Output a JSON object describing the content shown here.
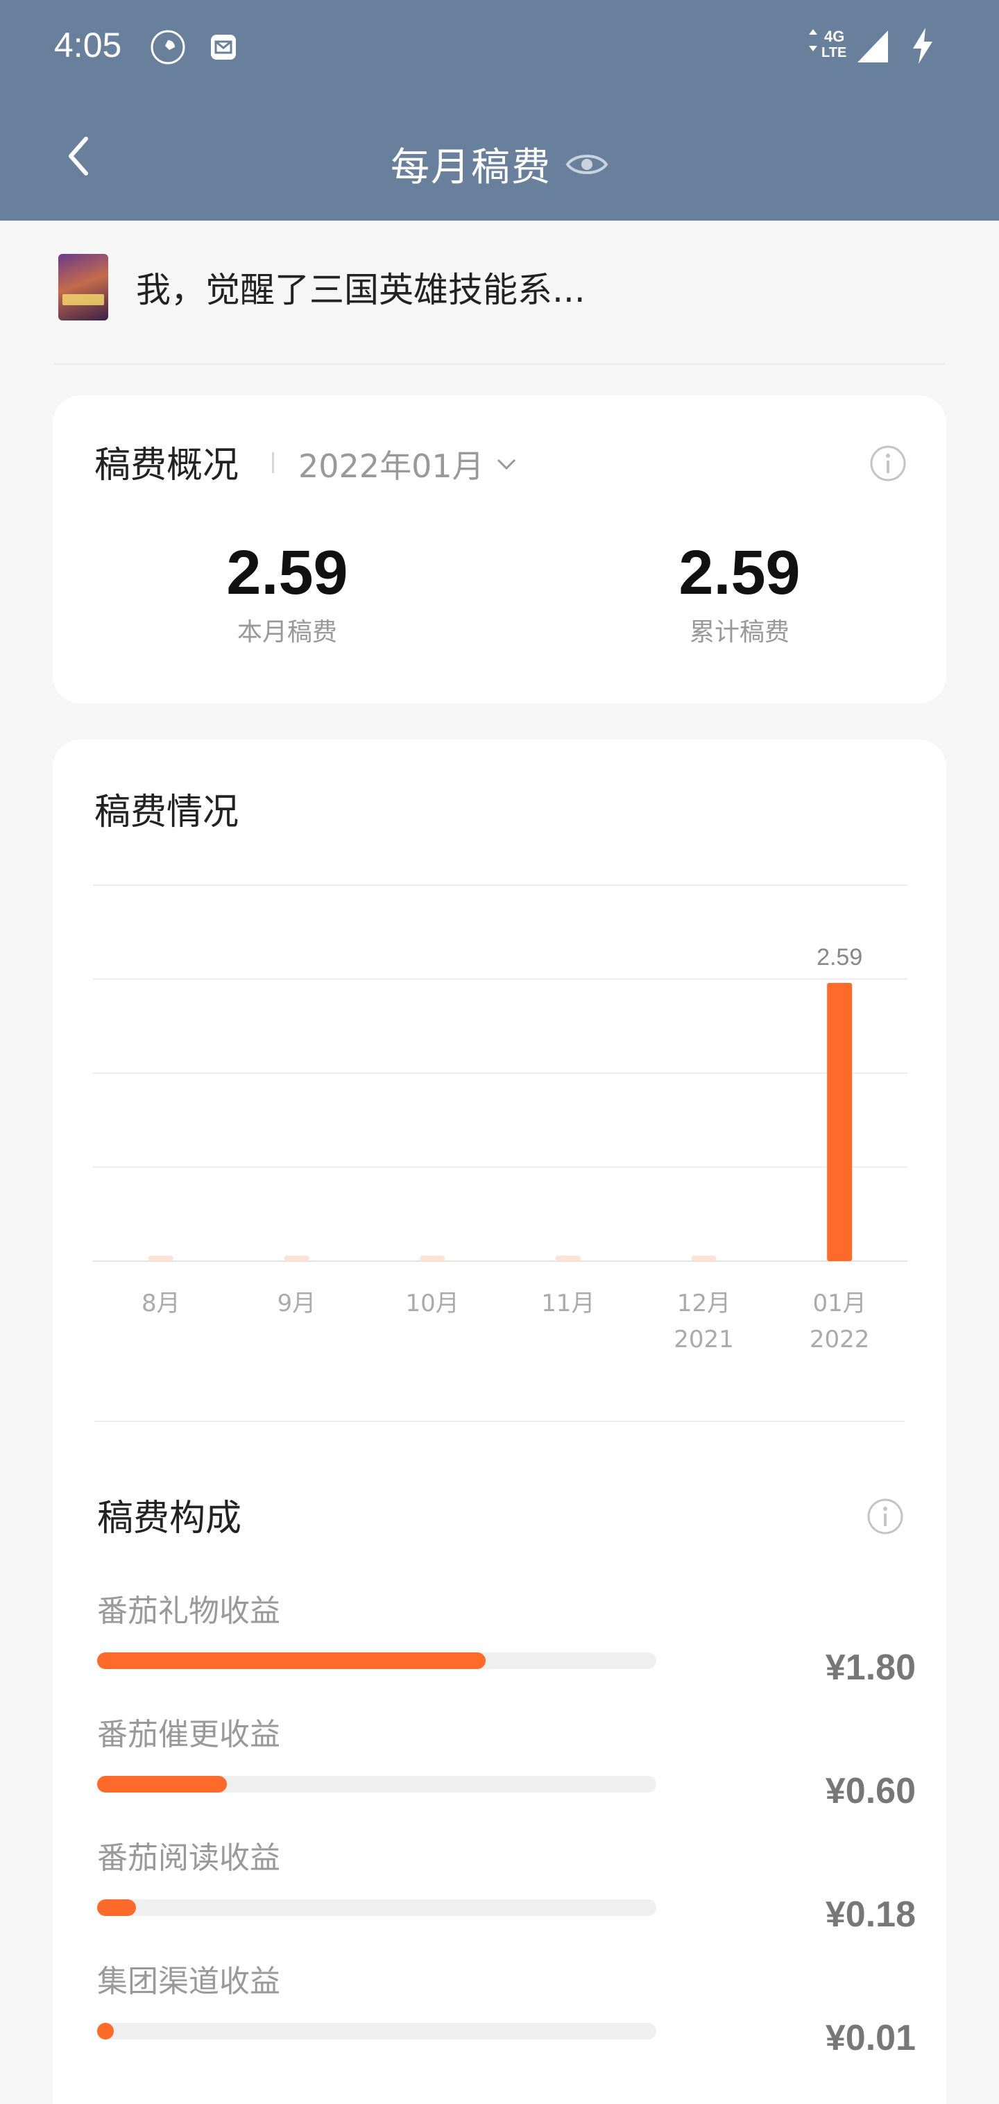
{
  "status_bar": {
    "time": "4:05",
    "left_icons": [
      "rocket-icon",
      "mail-icon"
    ],
    "network": "4G LTE",
    "right_icons": [
      "signal-icon",
      "charging-icon"
    ]
  },
  "nav": {
    "back_icon": "chevron-left-icon",
    "title": "每月稿费",
    "title_icon": "eye-icon"
  },
  "book": {
    "title": "我，觉醒了三国英雄技能系..."
  },
  "overview": {
    "heading": "稿费概况",
    "month": "2022年01月",
    "stats": [
      {
        "value": "2.59",
        "label": "本月稿费"
      },
      {
        "value": "2.59",
        "label": "累计稿费"
      }
    ]
  },
  "chart_section": {
    "heading": "稿费情况"
  },
  "chart_data": {
    "type": "bar",
    "categories": [
      "8月",
      "9月",
      "10月",
      "11月",
      "12月\n2021",
      "01月\n2022"
    ],
    "category_lines": [
      [
        "8月"
      ],
      [
        "9月"
      ],
      [
        "10月"
      ],
      [
        "11月"
      ],
      [
        "12月",
        "2021"
      ],
      [
        "01月",
        "2022"
      ]
    ],
    "values": [
      0,
      0,
      0,
      0,
      0,
      2.59
    ],
    "data_labels": [
      "",
      "",
      "",
      "",
      "",
      "2.59"
    ],
    "ylim": [
      0,
      3.5
    ],
    "grid": true,
    "bar_color": "#fe6a2a",
    "empty_bar_color": "#fde3d6"
  },
  "breakdown": {
    "heading": "稿费构成",
    "items": [
      {
        "label": "番茄礼物收益",
        "value": "¥1.80",
        "fraction": 0.695
      },
      {
        "label": "番茄催更收益",
        "value": "¥0.60",
        "fraction": 0.232
      },
      {
        "label": "番茄阅读收益",
        "value": "¥0.18",
        "fraction": 0.069
      },
      {
        "label": "集团渠道收益",
        "value": "¥0.01",
        "fraction": 0.004
      }
    ]
  },
  "colors": {
    "header_bg": "#68809b",
    "accent": "#fe6a2a",
    "page_bg": "#f6f6f6"
  }
}
